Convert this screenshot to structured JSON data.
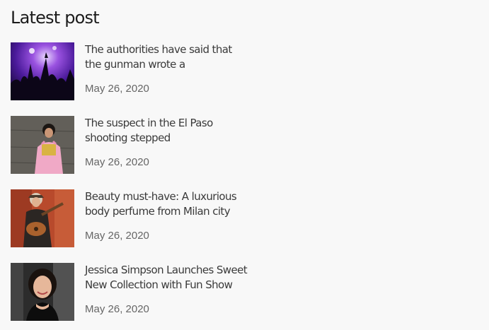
{
  "widget": {
    "title": "Latest post"
  },
  "posts": [
    {
      "title": "The authorities have said that the gunman wrote a",
      "date": "May 26, 2020",
      "thumbnail": "concert-crowd-image"
    },
    {
      "title": "The suspect in the El Paso shooting stepped",
      "date": "May 26, 2020",
      "thumbnail": "woman-pink-overalls-image"
    },
    {
      "title": "Beauty must-have: A luxurious body perfume from Milan city",
      "date": "May 26, 2020",
      "thumbnail": "guitar-player-image"
    },
    {
      "title": "Jessica Simpson Launches Sweet New Collection with Fun Show",
      "date": "May 26, 2020",
      "thumbnail": "smiling-woman-portrait-image"
    }
  ]
}
